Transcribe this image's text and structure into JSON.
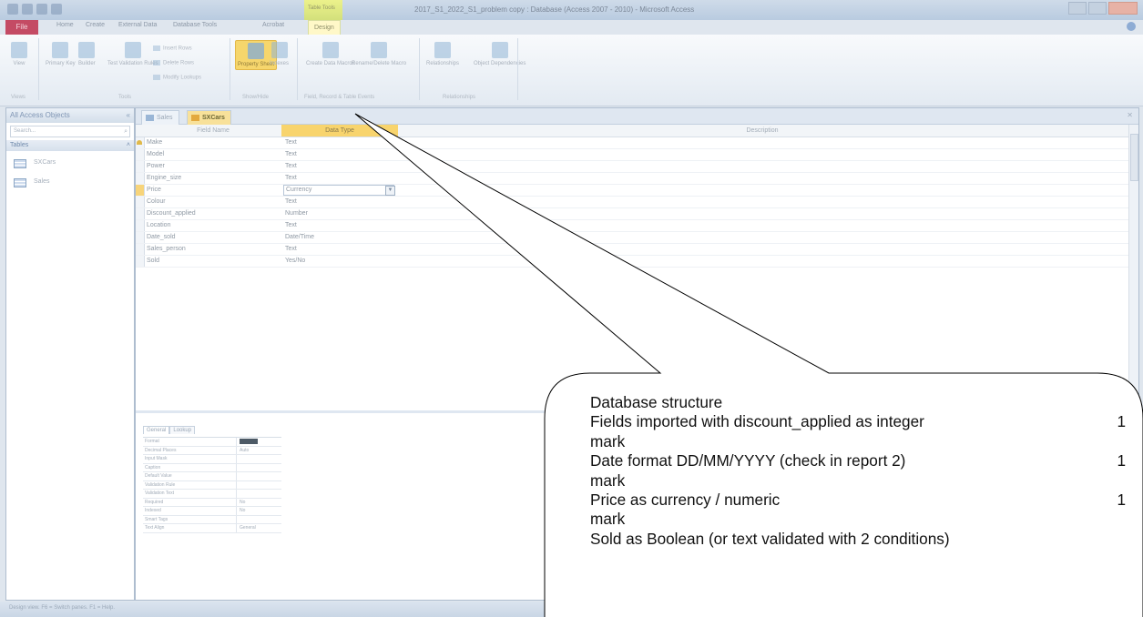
{
  "window": {
    "title": "2017_S1_2022_S1_problem copy : Database (Access 2007 - 2010) - Microsoft Access",
    "context_tab_group": "Table Tools"
  },
  "ribbon": {
    "tabs": [
      "File",
      "Home",
      "Create",
      "External Data",
      "Database Tools",
      "Acrobat",
      "Design"
    ],
    "buttons": {
      "view": "View",
      "primary_key": "Primary Key",
      "builder": "Builder",
      "test_validation": "Test Validation Rules",
      "insert_rows": "Insert Rows",
      "delete_rows": "Delete Rows",
      "modify_lookups": "Modify Lookups",
      "property_sheet": "Property Sheet",
      "indexes": "Indexes",
      "create_data_macros": "Create Data Macros",
      "rename_delete_macro": "Rename/Delete Macro",
      "relationships": "Relationships",
      "object_dependencies": "Object Dependencies"
    },
    "groups": [
      "Views",
      "Tools",
      "Show/Hide",
      "Field, Record & Table Events",
      "Relationships"
    ]
  },
  "nav_pane": {
    "header": "All Access Objects",
    "search_placeholder": "Search...",
    "group": "Tables",
    "items": [
      "SXCars",
      "Sales"
    ]
  },
  "document": {
    "tabs": [
      "Sales",
      "SXCars"
    ],
    "active_tab": "SXCars",
    "columns": [
      "Field Name",
      "Data Type",
      "Description"
    ],
    "fields": [
      {
        "name": "Make",
        "type": "Text"
      },
      {
        "name": "Model",
        "type": "Text"
      },
      {
        "name": "Power",
        "type": "Text"
      },
      {
        "name": "Engine_size",
        "type": "Text"
      },
      {
        "name": "Price",
        "type": "Currency"
      },
      {
        "name": "Colour",
        "type": "Text"
      },
      {
        "name": "Discount_applied",
        "type": "Number"
      },
      {
        "name": "Location",
        "type": "Text"
      },
      {
        "name": "Date_sold",
        "type": "Date/Time"
      },
      {
        "name": "Sales_person",
        "type": "Text"
      },
      {
        "name": "Sold",
        "type": "Yes/No"
      }
    ]
  },
  "field_properties": {
    "tabs": [
      "General",
      "Lookup"
    ],
    "rows": [
      {
        "name": "Format",
        "value": ""
      },
      {
        "name": "Decimal Places",
        "value": "Auto"
      },
      {
        "name": "Input Mask",
        "value": ""
      },
      {
        "name": "Caption",
        "value": ""
      },
      {
        "name": "Default Value",
        "value": ""
      },
      {
        "name": "Validation Rule",
        "value": ""
      },
      {
        "name": "Validation Text",
        "value": ""
      },
      {
        "name": "Required",
        "value": "No"
      },
      {
        "name": "Indexed",
        "value": "No"
      },
      {
        "name": "Smart Tags",
        "value": ""
      },
      {
        "name": "Text Align",
        "value": "General"
      }
    ]
  },
  "status_bar": {
    "text": "Design view.  F6 = Switch panes.  F1 = Help."
  },
  "callout": {
    "lines": [
      {
        "text": "Database structure",
        "mark": ""
      },
      {
        "text": "Fields imported with discount_applied as integer",
        "mark": "1"
      },
      {
        "text": "mark",
        "mark": ""
      },
      {
        "text": "Date format DD/MM/YYYY (check in report 2)",
        "mark": "1"
      },
      {
        "text": "mark",
        "mark": ""
      },
      {
        "text": "Price as currency / numeric",
        "mark": "1"
      },
      {
        "text": "mark",
        "mark": ""
      },
      {
        "text": "Sold as Boolean (or text validated with 2 conditions)",
        "mark": ""
      }
    ]
  },
  "colors": {
    "accent_active": "#f8d46d",
    "file_tab": "#c23b56",
    "callout_fill": "#ffffff",
    "callout_stroke": "#000000"
  }
}
